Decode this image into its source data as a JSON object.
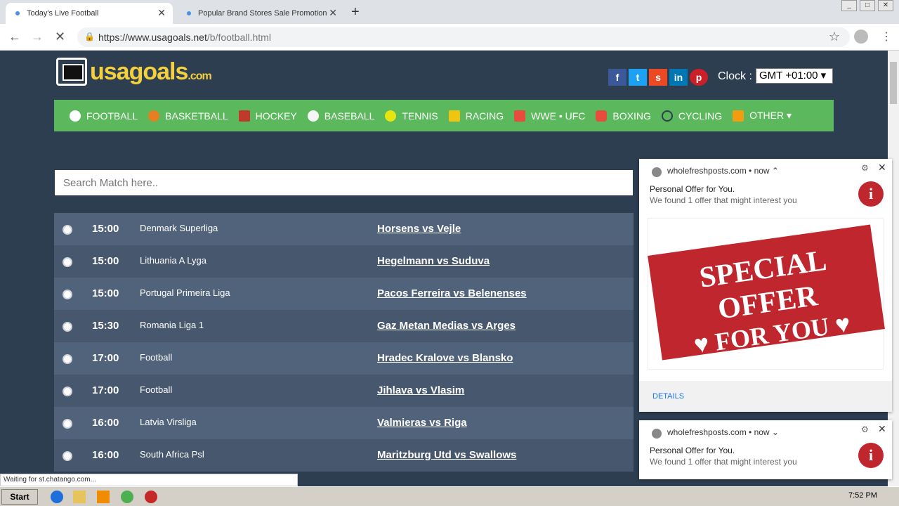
{
  "browser": {
    "tabs": [
      {
        "title": "Today's Live Football"
      },
      {
        "title": "Popular Brand Stores Sale Promotion"
      }
    ],
    "url_host": "https://www.usagoals.net",
    "url_path": "/b/football.html",
    "status": "Waiting for st.chatango.com..."
  },
  "site": {
    "logo": "usagoals",
    "logo_suffix": ".com",
    "socials": [
      {
        "name": "facebook-icon",
        "glyph": "f",
        "color": "#3b5998"
      },
      {
        "name": "twitter-icon",
        "glyph": "t",
        "color": "#1da1f2"
      },
      {
        "name": "stumbleupon-icon",
        "glyph": "s",
        "color": "#eb4924"
      },
      {
        "name": "linkedin-icon",
        "glyph": "in",
        "color": "#0077b5"
      },
      {
        "name": "pinterest-icon",
        "glyph": "p",
        "color": "#cb2027"
      }
    ],
    "clock_label": "Clock :",
    "clock_value": "GMT +01:00 ▾",
    "nav": [
      {
        "label": "FOOTBALL",
        "color": "#ffffff"
      },
      {
        "label": "BASKETBALL",
        "color": "#e67e22"
      },
      {
        "label": "HOCKEY",
        "color": "#c0392b"
      },
      {
        "label": "BASEBALL",
        "color": "#f5f5f5"
      },
      {
        "label": "TENNIS",
        "color": "#e5e510"
      },
      {
        "label": "RACING",
        "color": "#f1c40f"
      },
      {
        "label": "WWE • UFC",
        "color": "#e74c3c"
      },
      {
        "label": "BOXING",
        "color": "#e74c3c"
      },
      {
        "label": "CYCLING",
        "color": "#2c3e50"
      },
      {
        "label": "OTHER ▾",
        "color": "#f39c12"
      }
    ],
    "search_placeholder": "Search Match here.."
  },
  "matches": [
    {
      "time": "15:00",
      "league": "Denmark Superliga",
      "match": "Horsens vs Vejle"
    },
    {
      "time": "15:00",
      "league": "Lithuania A Lyga",
      "match": "Hegelmann vs Suduva"
    },
    {
      "time": "15:00",
      "league": "Portugal Primeira Liga",
      "match": "Pacos Ferreira vs Belenenses"
    },
    {
      "time": "15:30",
      "league": "Romania Liga 1",
      "match": "Gaz Metan Medias vs Arges"
    },
    {
      "time": "17:00",
      "league": "Football",
      "match": "Hradec Kralove vs Blansko"
    },
    {
      "time": "17:00",
      "league": "Football",
      "match": "Jihlava vs Vlasim"
    },
    {
      "time": "16:00",
      "league": "Latvia Virsliga",
      "match": "Valmieras vs Riga"
    },
    {
      "time": "16:00",
      "league": "South Africa Psl",
      "match": "Maritzburg Utd vs Swallows"
    }
  ],
  "notification": {
    "source": "wholefreshposts.com • now ⌃",
    "title": "Personal Offer for You.",
    "body": "We found 1 offer that might interest you",
    "stamp_line1": "SPECIAL OFFER",
    "stamp_line2": "♥ FOR YOU ♥",
    "details": "DETAILS"
  },
  "notification2": {
    "source": "wholefreshposts.com • now ⌄",
    "title": "Personal Offer for You.",
    "body": "We found 1 offer that might interest you"
  },
  "taskbar": {
    "start": "Start",
    "time": "7:52 PM"
  }
}
